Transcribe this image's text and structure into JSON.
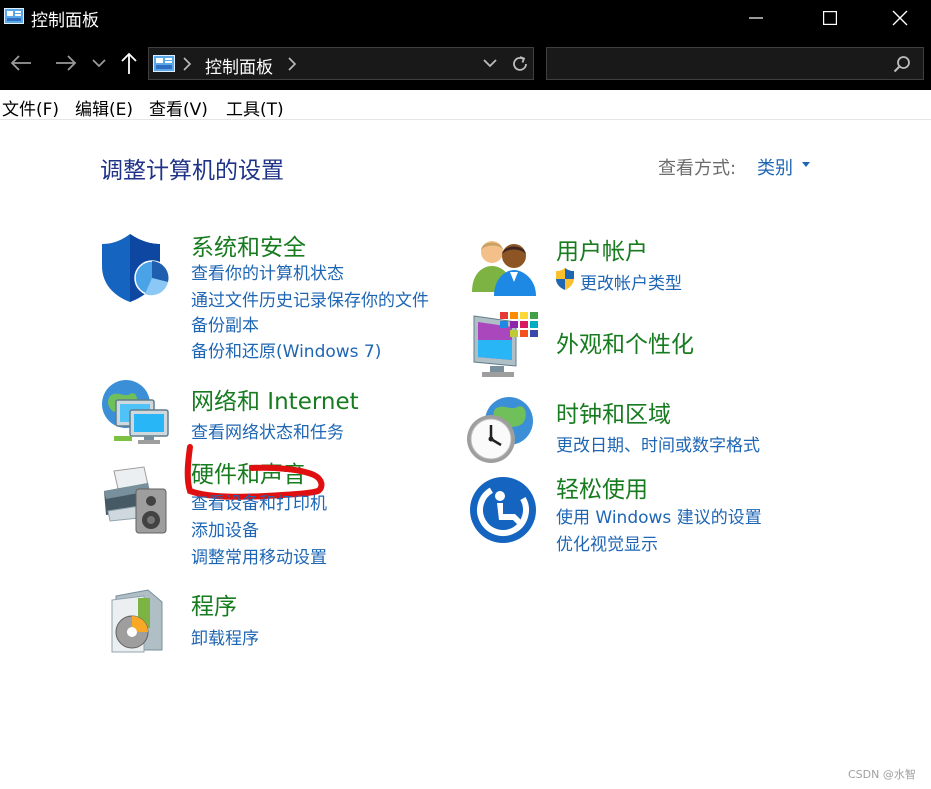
{
  "window": {
    "title": "控制面板"
  },
  "address_bar": {
    "breadcrumb": "控制面板"
  },
  "search": {
    "value": "",
    "placeholder": ""
  },
  "menu": {
    "items": [
      "文件(F)",
      "编辑(E)",
      "查看(V)",
      "工具(T)"
    ]
  },
  "main": {
    "heading": "调整计算机的设置",
    "view_by_label": "查看方式:",
    "view_by_value": "类别",
    "categories": [
      {
        "title": "系统和安全",
        "icon": "shield-icon",
        "links": [
          "查看你的计算机状态",
          "通过文件历史记录保存你的文件",
          "备份副本",
          "备份和还原(Windows 7)"
        ]
      },
      {
        "title": "网络和 Internet",
        "icon": "network-globe-icon",
        "links": [
          "查看网络状态和任务"
        ]
      },
      {
        "title": "硬件和声音",
        "icon": "printer-speaker-icon",
        "links": [
          "查看设备和打印机",
          "添加设备",
          "调整常用移动设置"
        ]
      },
      {
        "title": "程序",
        "icon": "programs-disc-icon",
        "links": [
          "卸载程序"
        ]
      },
      {
        "title": "用户帐户",
        "icon": "users-icon",
        "links": [
          "更改帐户类型"
        ]
      },
      {
        "title": "外观和个性化",
        "icon": "monitor-palette-icon",
        "links": []
      },
      {
        "title": "时钟和区域",
        "icon": "clock-globe-icon",
        "links": [
          "更改日期、时间或数字格式"
        ]
      },
      {
        "title": "轻松使用",
        "icon": "ease-of-access-icon",
        "links": [
          "使用 Windows 建议的设置",
          "优化视觉显示"
        ]
      }
    ]
  },
  "colors": {
    "titlebar_bg": "#000000",
    "heading": "#1e3287",
    "category_title": "#177b1f",
    "link": "#1e66b4",
    "annotation": "#e01010"
  },
  "watermark": "CSDN @水智"
}
